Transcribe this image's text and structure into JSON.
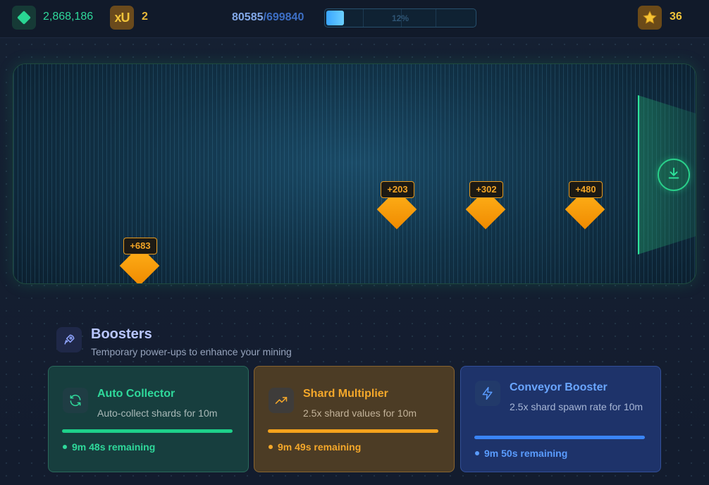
{
  "topbar": {
    "gems": "2,868,186",
    "xu_label": "xU",
    "xu_count": "2",
    "progress_current": "80585",
    "progress_separator": "/",
    "progress_total": "699840",
    "progress_percent_label": "12%",
    "progress_fraction": 0.12,
    "stars": "36",
    "colors": {
      "gem": "#2fd99b",
      "xu": "#e9b93a",
      "progress": "#3aa5ff",
      "star": "#f0c43a"
    }
  },
  "conveyor": {
    "collector_icon": "download-icon",
    "shards": [
      {
        "value": "+683"
      },
      {
        "value": "+203"
      },
      {
        "value": "+302"
      },
      {
        "value": "+480"
      }
    ]
  },
  "boosters": {
    "title": "Boosters",
    "subtitle": "Temporary power-ups to enhance your mining",
    "header_icon": "rocket-icon",
    "cards": [
      {
        "name": "Auto Collector",
        "description": "Auto-collect shards for 10m",
        "remaining": "9m 48s remaining",
        "icon": "refresh-icon",
        "color": "#2fd99b"
      },
      {
        "name": "Shard Multiplier",
        "description": "2.5x shard values for 10m",
        "remaining": "9m 49s remaining",
        "icon": "trending-up-icon",
        "color": "#f5a82a"
      },
      {
        "name": "Conveyor Booster",
        "description": "2.5x shard spawn rate for 10m",
        "remaining": "9m 50s remaining",
        "icon": "lightning-icon",
        "color": "#5a9cff"
      }
    ]
  }
}
